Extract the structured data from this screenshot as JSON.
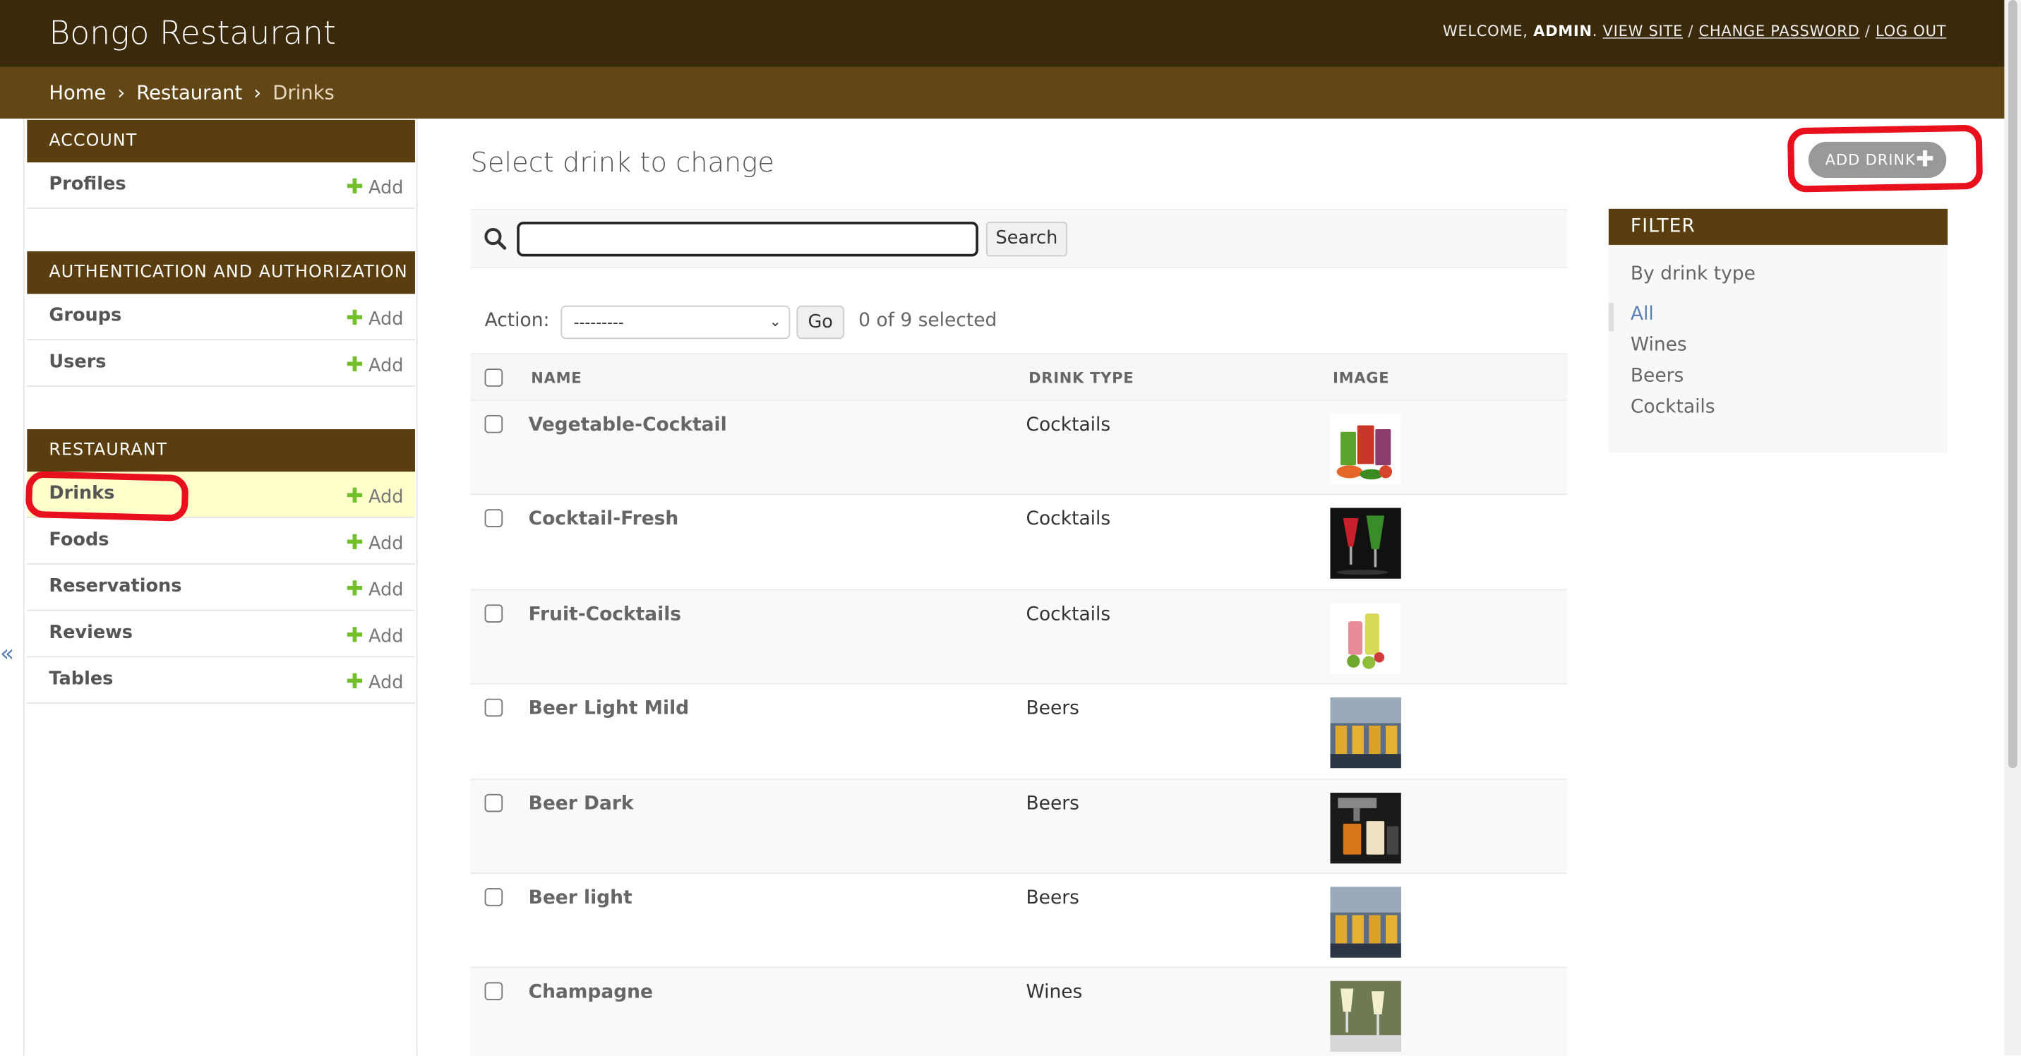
{
  "header": {
    "site_title": "Bongo Restaurant",
    "welcome": "WELCOME,",
    "username": "ADMIN",
    "view_site": "VIEW SITE",
    "change_password": "CHANGE PASSWORD",
    "log_out": "LOG OUT"
  },
  "breadcrumbs": {
    "home": "Home",
    "app": "Restaurant",
    "current": "Drinks",
    "sep": "›"
  },
  "sidebar": {
    "add_label": "Add",
    "modules": [
      {
        "caption": "Account",
        "items": [
          {
            "name": "Profiles"
          }
        ]
      },
      {
        "caption": "Authentication and Authorization",
        "items": [
          {
            "name": "Groups"
          },
          {
            "name": "Users"
          }
        ]
      },
      {
        "caption": "Restaurant",
        "items": [
          {
            "name": "Drinks"
          },
          {
            "name": "Foods"
          },
          {
            "name": "Reservations"
          },
          {
            "name": "Reviews"
          },
          {
            "name": "Tables"
          }
        ]
      }
    ],
    "collapse_glyph": "«"
  },
  "content": {
    "title": "Select drink to change",
    "add_button": "ADD DRINK",
    "search_button": "Search",
    "search_value": "",
    "action_label": "Action:",
    "action_selected": "---------",
    "go_button": "Go",
    "selected_count": "0 of 9 selected",
    "columns": [
      "Name",
      "Drink type",
      "Image"
    ],
    "rows": [
      {
        "name": "Vegetable-Cocktail",
        "type": "Cocktails",
        "image_icon": "vegetable-juice-image"
      },
      {
        "name": "Cocktail-Fresh",
        "type": "Cocktails",
        "image_icon": "cocktail-dark-image"
      },
      {
        "name": "Fruit-Cocktails",
        "type": "Cocktails",
        "image_icon": "fruit-cocktail-image"
      },
      {
        "name": "Beer Light Mild",
        "type": "Beers",
        "image_icon": "beer-glasses-image"
      },
      {
        "name": "Beer Dark",
        "type": "Beers",
        "image_icon": "beer-tap-image"
      },
      {
        "name": "Beer light",
        "type": "Beers",
        "image_icon": "beer-glasses-image"
      },
      {
        "name": "Champagne",
        "type": "Wines",
        "image_icon": "champagne-glasses-image"
      }
    ]
  },
  "filter": {
    "title": "Filter",
    "heading": "By drink type",
    "options": [
      "All",
      "Wines",
      "Beers",
      "Cocktails"
    ],
    "selected": "All"
  },
  "colors": {
    "header": "#3b290b",
    "breadcrumbs": "#634616",
    "module_caption": "#5a3e0f",
    "annotation": "#e8101c",
    "link": "#5b80b2",
    "add_plus": "#70bf2b"
  }
}
